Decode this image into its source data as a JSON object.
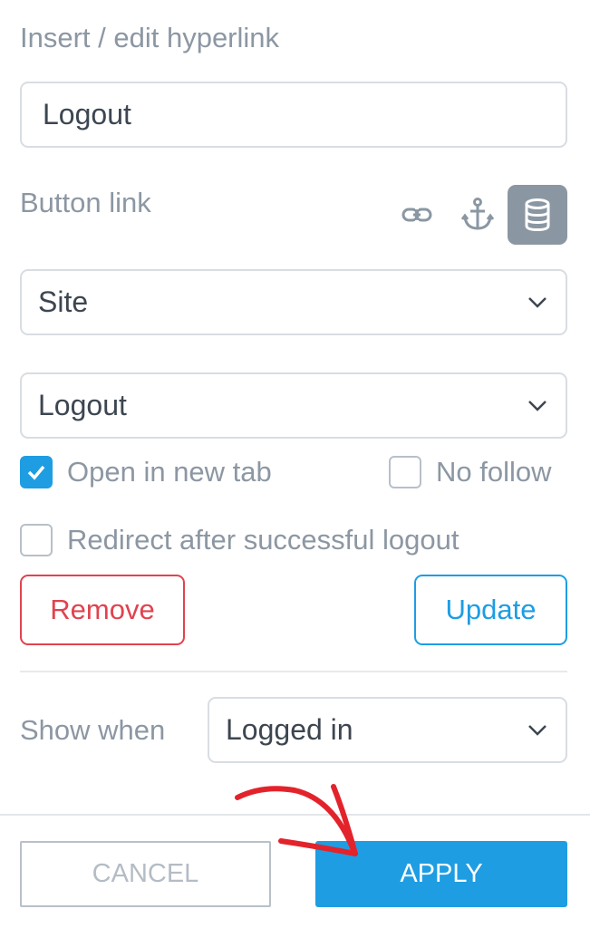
{
  "dialog": {
    "title": "Insert / edit hyperlink",
    "link_text_value": "Logout",
    "button_link_label": "Button link",
    "link_type_icons": [
      {
        "icon": "link-icon",
        "active": false
      },
      {
        "icon": "anchor-icon",
        "active": false
      },
      {
        "icon": "database-icon",
        "active": true
      }
    ],
    "link_source_select": {
      "selected": "Site"
    },
    "page_select": {
      "selected": "Logout"
    },
    "open_new_tab": {
      "label": "Open in new tab",
      "checked": true
    },
    "no_follow": {
      "label": "No follow",
      "checked": false
    },
    "redirect_after_logout": {
      "label": "Redirect after successful logout",
      "checked": false
    },
    "remove_label": "Remove",
    "update_label": "Update",
    "show_when_label": "Show when",
    "show_when_select": {
      "selected": "Logged in"
    }
  },
  "footer": {
    "cancel_label": "CANCEL",
    "apply_label": "APPLY"
  },
  "colors": {
    "accent": "#1e9de3",
    "danger": "#e0434f",
    "annotation_arrow": "#e3232b",
    "muted_text": "#8c97a3"
  }
}
